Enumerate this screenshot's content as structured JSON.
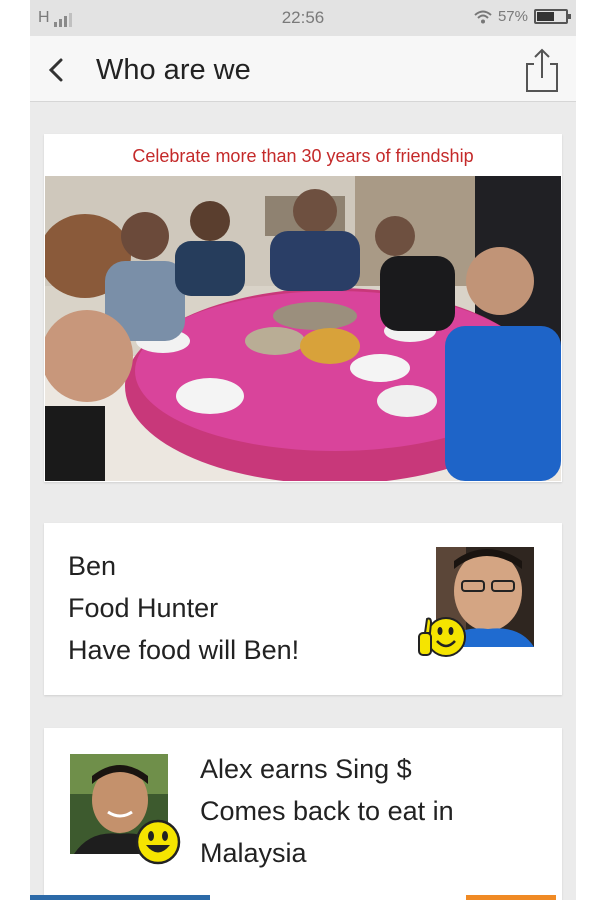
{
  "status_bar": {
    "carrier": "H",
    "time": "22:56",
    "battery_percent": "57%",
    "battery_level": 0.57,
    "icons": [
      "signal-icon",
      "wifi-icon",
      "battery-icon"
    ]
  },
  "header": {
    "title": "Who are we",
    "back_icon": "back-arrow-icon",
    "share_icon": "share-icon"
  },
  "group_card": {
    "caption": "Celebrate more than 30 years of friendship",
    "caption_color": "#c42a2a"
  },
  "members": [
    {
      "name": "Ben",
      "role": "Food Hunter",
      "tagline": "Have food will Ben!",
      "emoji": "thumbs-up-smiley-icon"
    },
    {
      "line1": "Alex earns Sing $",
      "line2": "Comes back to eat in",
      "line3": "Malaysia",
      "emoji": "smiley-icon"
    }
  ],
  "colors": {
    "background": "#ebebeb",
    "header_bg": "#f7f7f7",
    "status_bg": "#e3e3e3",
    "text": "#222222",
    "emoji_yellow": "#f5e400"
  }
}
